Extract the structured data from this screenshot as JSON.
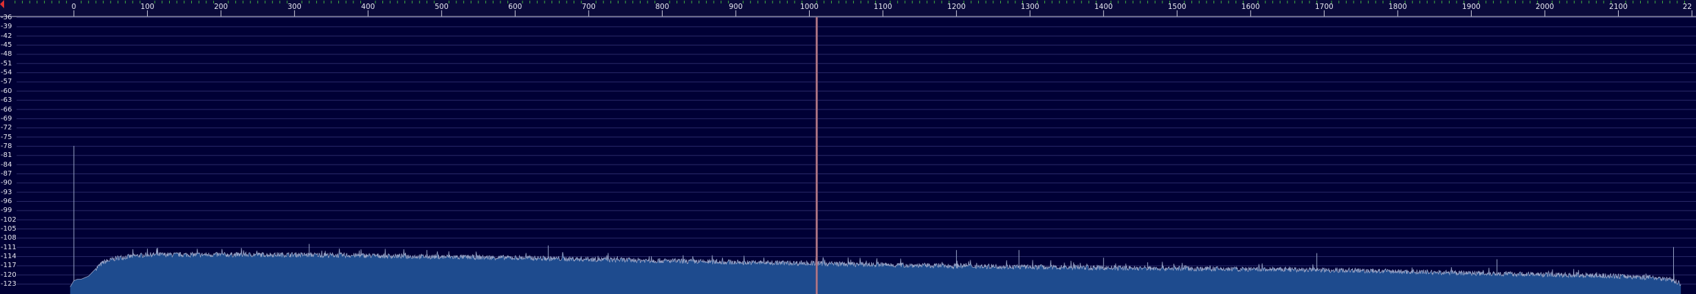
{
  "ruler": {
    "marker_color": "#e03030",
    "tick_labels": [
      "0",
      "100",
      "200",
      "300",
      "400",
      "500",
      "600",
      "700",
      "800",
      "900",
      "1000",
      "1100",
      "1200",
      "1300",
      "1400",
      "1500",
      "1600",
      "1700",
      "1800",
      "1900",
      "2000",
      "2100",
      "22"
    ]
  },
  "y_axis": {
    "labels": [
      "-36",
      "-39",
      "-42",
      "-45",
      "-48",
      "-51",
      "-54",
      "-57",
      "-60",
      "-63",
      "-66",
      "-69",
      "-72",
      "-75",
      "-78",
      "-81",
      "-84",
      "-87",
      "-90",
      "-93",
      "-96",
      "-99",
      "-102",
      "-105",
      "-108",
      "-111",
      "-114",
      "-117",
      "-120",
      "-123"
    ]
  },
  "colors": {
    "background": "#000035",
    "grid": "#2a2a6a",
    "spectrum_fill": "#1e4b8e",
    "spectrum_line": "#9aa6c8",
    "cursor_line": "#a06070"
  },
  "chart_data": {
    "type": "area",
    "title": "",
    "xlabel": "",
    "ylabel": "",
    "xlim": [
      0,
      2200
    ],
    "ylim": [
      -123,
      -36
    ],
    "cursor_x": 1010,
    "baseline_points": {
      "x": [
        -5,
        0,
        5,
        10,
        20,
        30,
        40,
        60,
        100,
        200,
        300,
        400,
        500,
        600,
        700,
        800,
        900,
        1000,
        1100,
        1200,
        1300,
        1400,
        1500,
        1600,
        1700,
        1800,
        1900,
        2000,
        2100,
        2150,
        2170,
        2185
      ],
      "y": [
        -124,
        -122,
        -121.5,
        -121.5,
        -120.5,
        -118,
        -116,
        -114.5,
        -113.5,
        -113.5,
        -113.5,
        -113.8,
        -114.2,
        -114.5,
        -115.0,
        -115.5,
        -116.0,
        -116.3,
        -116.8,
        -117.2,
        -117.5,
        -117.8,
        -118.0,
        -118.3,
        -118.5,
        -119.0,
        -119.5,
        -120.0,
        -120.5,
        -121.0,
        -121.5,
        -123.0
      ]
    },
    "peaks": {
      "x": [
        0,
        320,
        480,
        645,
        960,
        1010,
        1200,
        1285,
        1400,
        1460,
        1690,
        1935,
        2175
      ],
      "y": [
        -78,
        -110,
        -112,
        -110.5,
        -116,
        -36,
        -112,
        -112,
        -114.5,
        -116,
        -113,
        -115,
        -111
      ]
    }
  }
}
